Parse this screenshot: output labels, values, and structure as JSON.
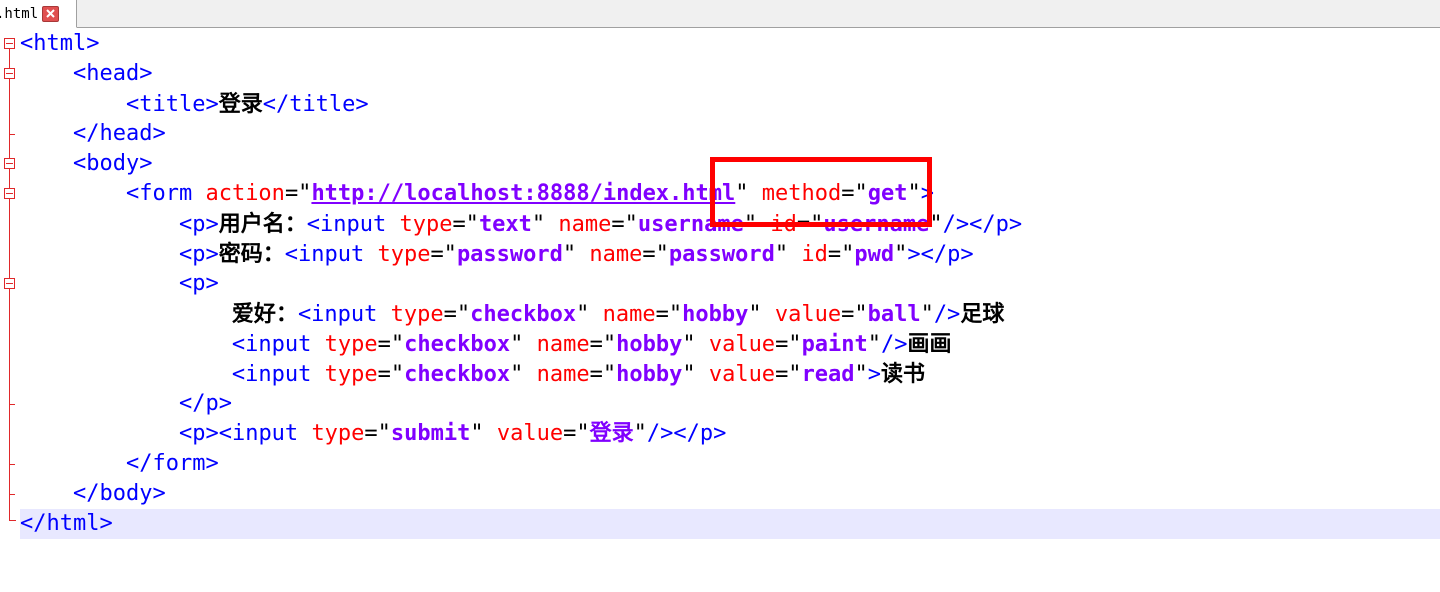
{
  "tab": {
    "label": ".html",
    "close_icon": "close-icon"
  },
  "colors": {
    "tag": "#0000ff",
    "attribute": "#ff0000",
    "value": "#8000ff",
    "current_line": "#e8e8ff",
    "annotation": "#ff0000"
  },
  "code": {
    "l1": {
      "open": "<html>"
    },
    "l2": {
      "open": "<head>"
    },
    "l3": {
      "open": "<title>",
      "text": "登录",
      "close": "</title>"
    },
    "l4": {
      "close": "</head>"
    },
    "l5": {
      "open": "<body>"
    },
    "l6": {
      "tag": "<form",
      "attr1": "action",
      "url": "http://localhost:8888/index.html",
      "attr2": "method",
      "val2": "get",
      "end": ">"
    },
    "l7": {
      "p": "<p>",
      "label": "用户名：",
      "tag": "<input",
      "a1": "type",
      "v1": "text",
      "a2": "name",
      "v2": "username",
      "a3": "id",
      "v3": "username",
      "end": "/></p>"
    },
    "l8": {
      "p": "<p>",
      "label": "密码：",
      "tag": "<input",
      "a1": "type",
      "v1": "password",
      "a2": "name",
      "v2": "password",
      "a3": "id",
      "v3": "pwd",
      "end": "></p>"
    },
    "l9": {
      "p": "<p>"
    },
    "l10": {
      "label": "爱好：",
      "tag": "<input",
      "a1": "type",
      "v1": "checkbox",
      "a2": "name",
      "v2": "hobby",
      "a3": "value",
      "v3": "ball",
      "end": "/>",
      "after": "足球"
    },
    "l11": {
      "tag": "<input",
      "a1": "type",
      "v1": "checkbox",
      "a2": "name",
      "v2": "hobby",
      "a3": "value",
      "v3": "paint",
      "end": "/>",
      "after": "画画"
    },
    "l12": {
      "tag": "<input",
      "a1": "type",
      "v1": "checkbox",
      "a2": "name",
      "v2": "hobby",
      "a3": "value",
      "v3": "read",
      "end": ">",
      "after": "读书"
    },
    "l13": {
      "close": "</p>"
    },
    "l14": {
      "p": "<p>",
      "tag": "<input",
      "a1": "type",
      "v1": "submit",
      "a2": "value",
      "v2": "登录",
      "end": "/></p>"
    },
    "l15": {
      "close": "</form>"
    },
    "l16": {
      "close": "</body>"
    },
    "l17": {
      "close": "</html>"
    }
  }
}
